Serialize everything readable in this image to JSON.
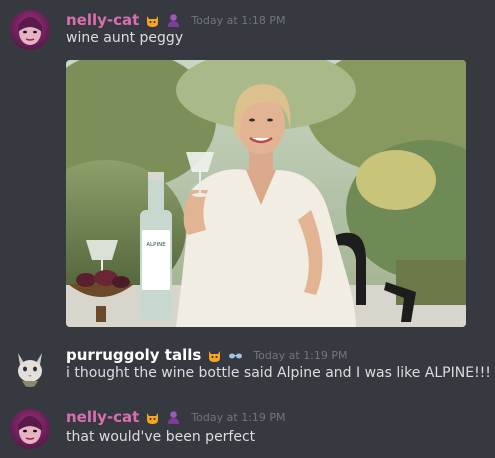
{
  "messages": [
    {
      "username": "nelly-cat",
      "username_color": "#d86fb0",
      "badges": [
        "cat-face-icon",
        "purple-figure-icon"
      ],
      "timestamp": "Today at 1:18 PM",
      "text": "wine aunt peggy",
      "has_image": true,
      "image_alt": "woman in white dress holding wine glass with bottle labeled ALPINE"
    },
    {
      "username": "purruggoly talls",
      "username_color": "#ffffff",
      "badges": [
        "cat-face-icon",
        "sunglasses-icon"
      ],
      "timestamp": "Today at 1:19 PM",
      "text": "i thought the wine bottle said Alpine and I was like ALPINE!!!"
    },
    {
      "username": "nelly-cat",
      "username_color": "#d86fb0",
      "badges": [
        "cat-face-icon",
        "purple-figure-icon"
      ],
      "timestamp": "Today at 1:19 PM",
      "text": "that would've been perfect"
    }
  ],
  "bottle_label": "ALPINE"
}
